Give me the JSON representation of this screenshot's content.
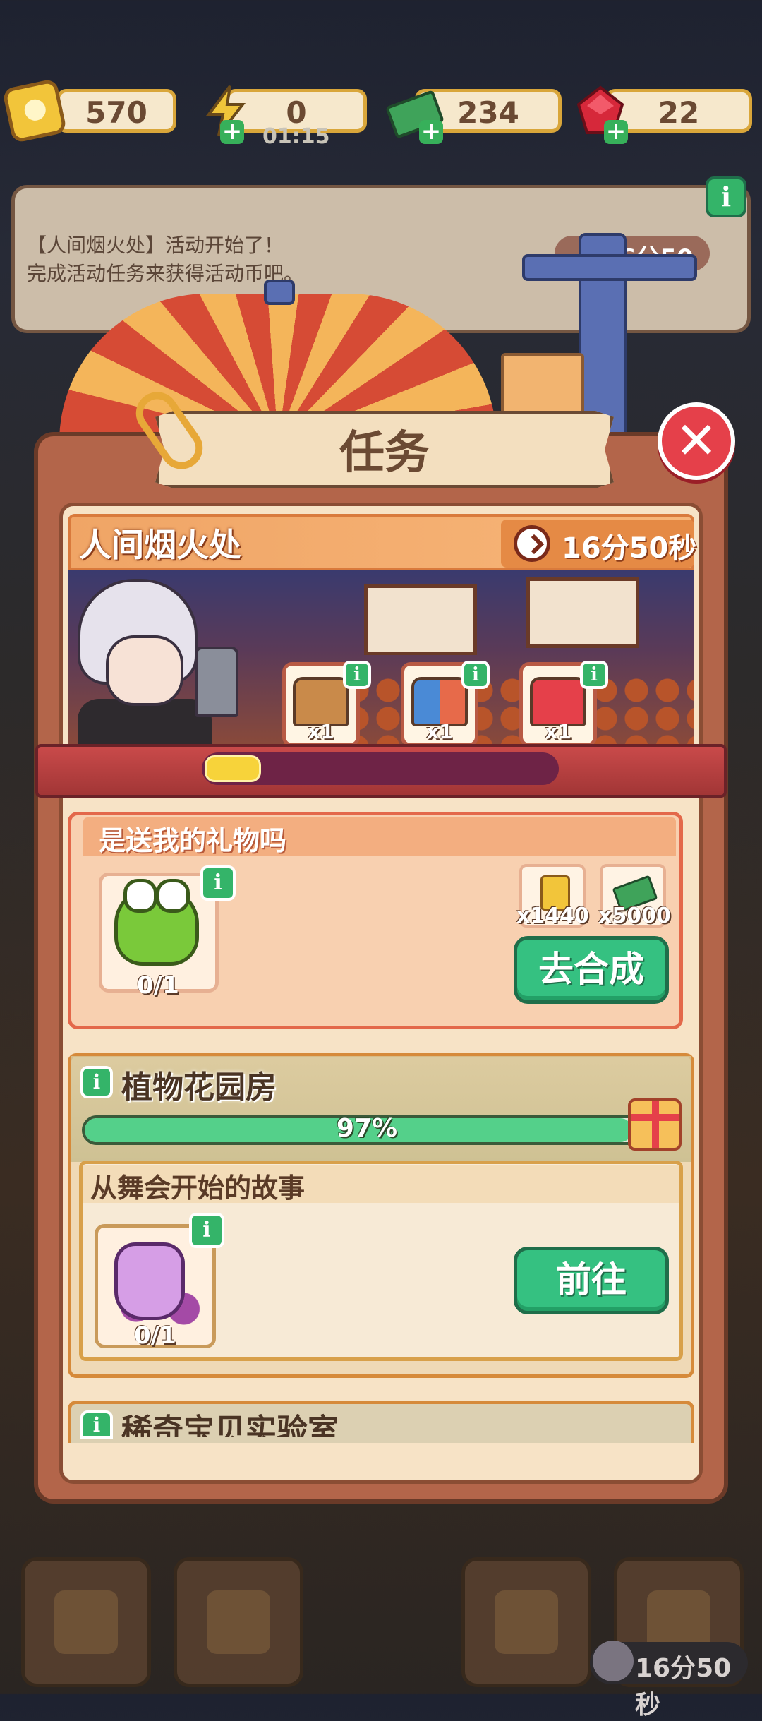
{
  "resources": {
    "tickets": "570",
    "energy": "0",
    "energy_timer": "01:15",
    "cash": "234",
    "gems": "22"
  },
  "event_banner": {
    "line1": "【人间烟火处】活动开始了！",
    "line2": "完成活动任务来获得活动币吧。",
    "timer": "16分50秒"
  },
  "panel": {
    "title": "任务"
  },
  "event": {
    "name": "人间烟火处",
    "timer": "16分50秒",
    "progress": 0.16,
    "chests": [
      {
        "icon": "wooden-chest-icon",
        "count": "x1"
      },
      {
        "icon": "blue-chest-icon",
        "count": "x1"
      },
      {
        "icon": "red-chest-icon",
        "count": "x1"
      }
    ]
  },
  "task1": {
    "title": "是送我的礼物吗",
    "item_count": "0/1",
    "rewards": [
      {
        "icon": "ticket-icon",
        "count": "x1440"
      },
      {
        "icon": "cash-icon",
        "count": "x5000"
      }
    ],
    "button": "去合成"
  },
  "task2": {
    "title": "植物花园房",
    "progress_text": "97%",
    "progress": 0.97,
    "subtitle": "从舞会开始的故事",
    "item_count": "0/1",
    "button": "前往"
  },
  "task3": {
    "title": "稀奇宝贝实验室"
  },
  "bottom": {
    "timer": "16分50秒"
  }
}
